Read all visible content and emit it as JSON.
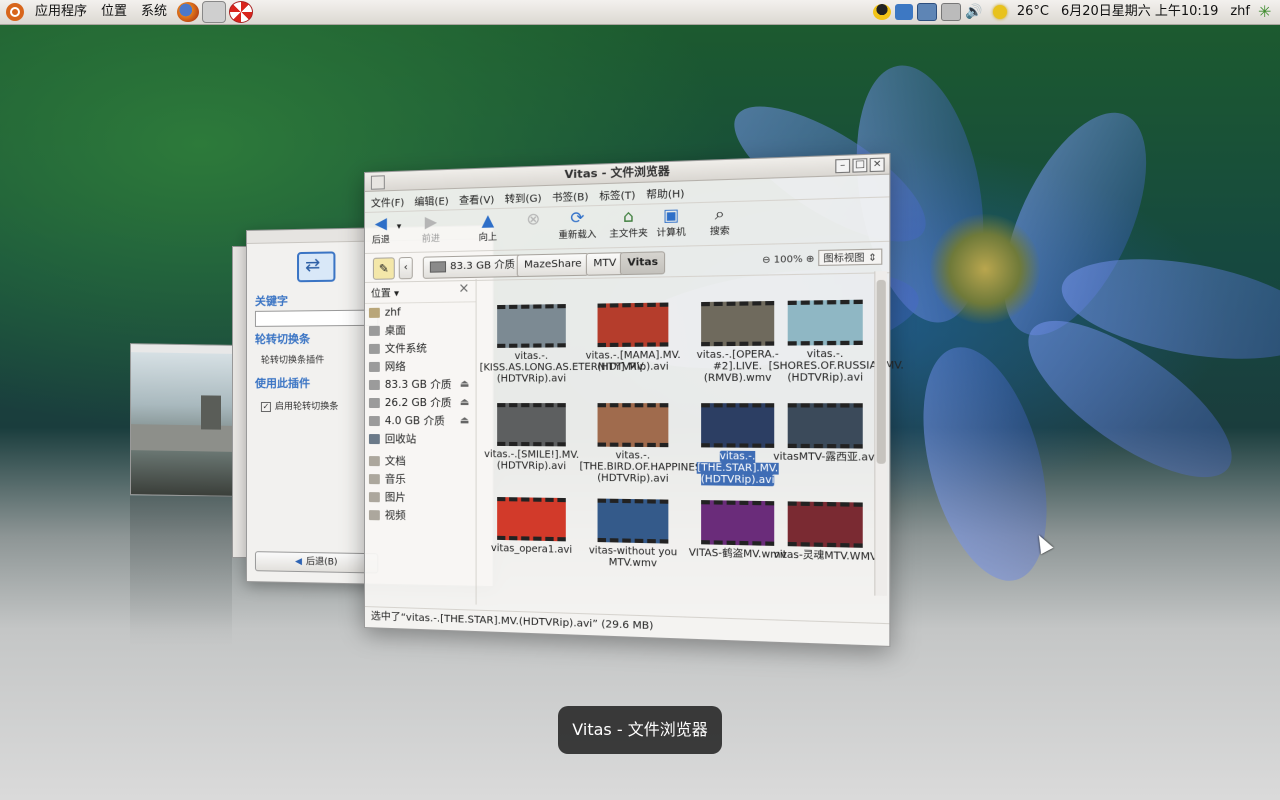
{
  "panel": {
    "menus": [
      "应用程序",
      "位置",
      "系统"
    ],
    "temperature": "26°C",
    "datetime": "6月20日星期六 上午10:19",
    "user": "zhf"
  },
  "settings_window": {
    "keyword_label": "关键字",
    "section_title": "轮转切换条",
    "plugin_name": "轮转切换条插件",
    "enable_header": "使用此插件",
    "enable_checkbox": "启用轮转切换条",
    "back_button": "后退(B)"
  },
  "window": {
    "title": "Vitas - 文件浏览器",
    "menus": [
      "文件(F)",
      "编辑(E)",
      "查看(V)",
      "转到(G)",
      "书签(B)",
      "标签(T)",
      "帮助(H)"
    ],
    "toolbar": {
      "back": "后退",
      "forward": "前进",
      "up": "向上",
      "reload": "重新载入",
      "home": "主文件夹",
      "computer": "计算机",
      "search": "搜索"
    },
    "location": {
      "crumbs": [
        "83.3 GB 介质",
        "MazeShare",
        "MTV",
        "Vitas"
      ],
      "zoom": "100%",
      "view_mode": "图标视图"
    },
    "sidebar": {
      "header": "位置",
      "items": [
        {
          "label": "zhf",
          "icon": "home-icon"
        },
        {
          "label": "桌面",
          "icon": "desktop-icon"
        },
        {
          "label": "文件系统",
          "icon": "drive-icon"
        },
        {
          "label": "网络",
          "icon": "network-icon"
        },
        {
          "label": "83.3 GB 介质",
          "icon": "drive-icon",
          "eject": true
        },
        {
          "label": "26.2 GB 介质",
          "icon": "drive-icon",
          "eject": true
        },
        {
          "label": "4.0 GB 介质",
          "icon": "drive-icon",
          "eject": true
        },
        {
          "label": "回收站",
          "icon": "trash-icon"
        },
        {
          "label": "文档",
          "icon": "folder-icon"
        },
        {
          "label": "音乐",
          "icon": "folder-icon"
        },
        {
          "label": "图片",
          "icon": "folder-icon"
        },
        {
          "label": "视频",
          "icon": "folder-icon"
        }
      ]
    },
    "files": [
      {
        "name": "vitas.-.[KISS.AS.LONG.AS.ETERNITY].MV.(HDTVRip).avi",
        "thumb": "#7c8a93"
      },
      {
        "name": "vitas.-.[MAMA].MV.(HDTVRip).avi",
        "thumb": "#b53d2c"
      },
      {
        "name": "vitas.-.[OPERA.-#2].LIVE.(RMVB).wmv",
        "thumb": "#6f6a5d"
      },
      {
        "name": "vitas.-.[SHORES.OF.RUSSIA].MV.(HDTVRip).avi",
        "thumb": "#8fb7c4"
      },
      {
        "name": "vitas.-.[SMILE!].MV.(HDTVRip).avi",
        "thumb": "#5d5f60"
      },
      {
        "name": "vitas.-.[THE.BIRD.OF.HAPPINESS].LIVE.(HDTVRip).avi",
        "thumb": "#a06b4d"
      },
      {
        "name": "vitas.-.[THE.STAR].MV.(HDTVRip).avi",
        "thumb": "#2c3e63",
        "selected": true
      },
      {
        "name": "vitasMTV-露西亚.avi",
        "thumb": "#3b4a5a"
      },
      {
        "name": "vitas_opera1.avi",
        "thumb": "#d23a2a"
      },
      {
        "name": "vitas-without you MTV.wmv",
        "thumb": "#345a8a"
      },
      {
        "name": "VITAS-鹤盗MV.wmv",
        "thumb": "#6a2c7a"
      },
      {
        "name": "vitas-灵魂MTV.WMV",
        "thumb": "#7a2a32"
      }
    ],
    "status": "选中了“vitas.-.[THE.STAR].MV.(HDTVRip).avi” (29.6 MB)"
  },
  "switcher_caption": "Vitas - 文件浏览器"
}
